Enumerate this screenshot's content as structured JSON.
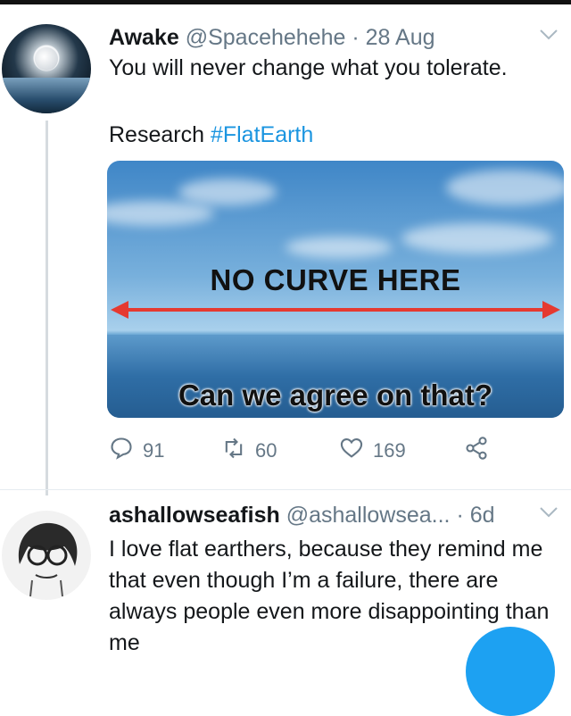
{
  "tweet1": {
    "display_name": "Awake",
    "handle": "@Spacehehehe",
    "separator": "·",
    "date": "28 Aug",
    "line1": "You will never change what you tolerate.",
    "line2_prefix": "Research",
    "hashtag": "#FlatEarth",
    "image": {
      "headline": "NO CURVE HERE",
      "caption": "Can we agree on that?"
    },
    "actions": {
      "reply_count": "91",
      "retweet_count": "60",
      "like_count": "169"
    }
  },
  "tweet2": {
    "display_name": "ashallowseafish",
    "handle": "@ashallowsea...",
    "separator": "·",
    "date": "6d",
    "body": "I love flat earthers, because they remind me that even though I’m a failure, there are always people even more disappointing than me"
  },
  "icons": {
    "reply": "reply-icon",
    "retweet": "retweet-icon",
    "like": "heart-icon",
    "share": "share-icon",
    "caret": "chevron-down-icon"
  },
  "colors": {
    "link": "#1b95e0",
    "meta": "#657786",
    "arrow": "#e53930",
    "fab": "#1da1f2"
  }
}
